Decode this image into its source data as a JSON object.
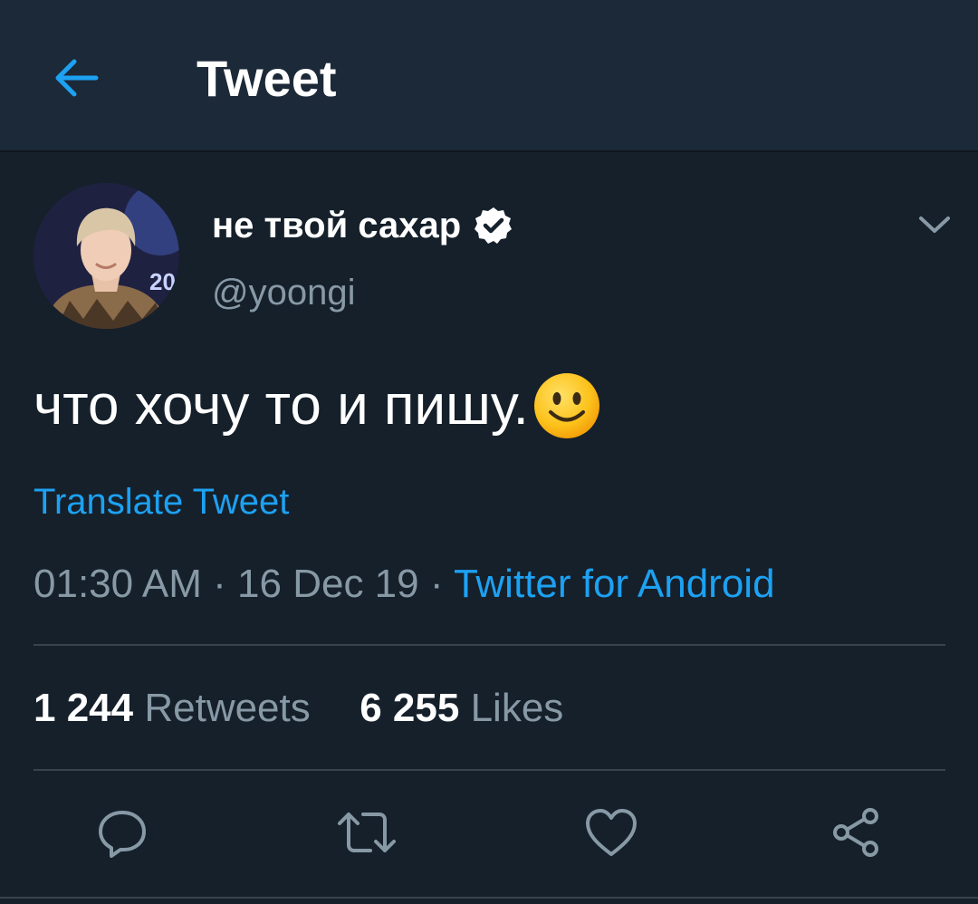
{
  "header": {
    "title": "Tweet",
    "back_icon": "arrow-left-icon"
  },
  "colors": {
    "background": "#15202b",
    "header_bg": "#1c2938",
    "accent": "#1da1f2",
    "secondary_text": "#8899a6",
    "divider": "#38444d"
  },
  "tweet": {
    "display_name": "не твой сахар",
    "verified_icon": "verified-badge-icon",
    "handle": "@yoongi",
    "menu_icon": "chevron-down-icon",
    "text": "что хочу то и пишу.",
    "emoji": "slightly-smiling-face-emoji",
    "translate_label": "Translate Tweet",
    "time": "01:30 AM",
    "date": "16 Dec 19",
    "separator": "·",
    "source": "Twitter for Android"
  },
  "stats": {
    "retweets_count": "1 244",
    "retweets_label": "Retweets",
    "likes_count": "6 255",
    "likes_label": "Likes"
  },
  "actions": {
    "reply_icon": "reply-icon",
    "retweet_icon": "retweet-icon",
    "like_icon": "heart-icon",
    "share_icon": "share-icon"
  }
}
